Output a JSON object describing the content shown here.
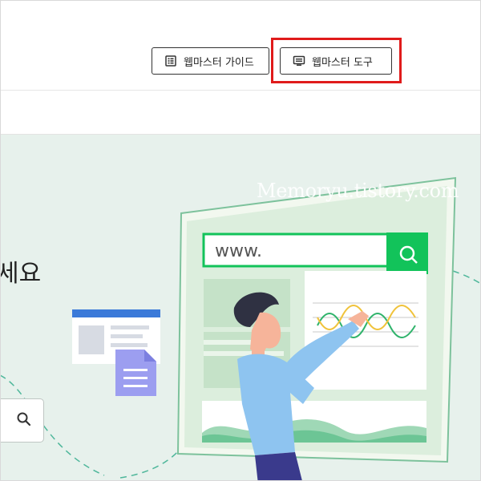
{
  "header": {
    "buttons": [
      {
        "label": "웹마스터 가이드",
        "icon": "list-icon"
      },
      {
        "label": "웹마스터 도구",
        "icon": "monitor-icon"
      }
    ],
    "highlight_color": "#e01b1b"
  },
  "hero": {
    "headline_fragment": "세요",
    "search_icon": "search-icon",
    "browser_url": "www.",
    "watermark": "Memoryu.tistory.com",
    "colors": {
      "background": "#e7f1ec",
      "accent_green": "#12c35a",
      "shirt_blue": "#8ec4f0",
      "doc_purple": "#9c9ef0"
    }
  }
}
